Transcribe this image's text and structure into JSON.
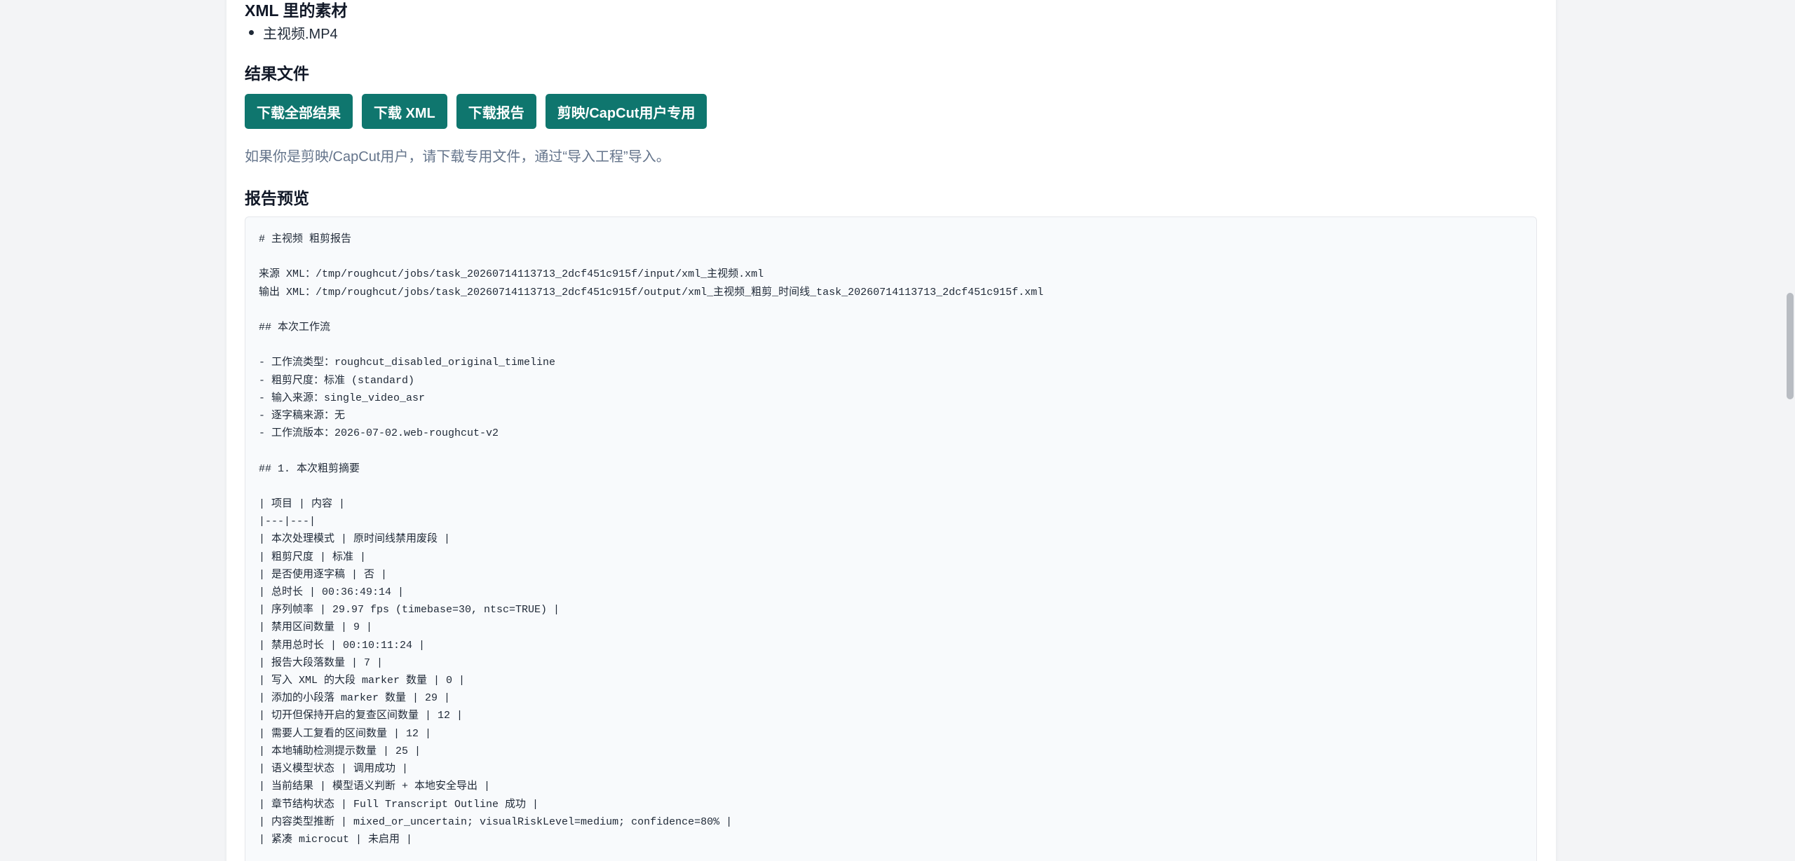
{
  "assets": {
    "title": "XML 里的素材",
    "items": [
      "主视频.MP4"
    ]
  },
  "results": {
    "title": "结果文件",
    "buttons": {
      "download_all": "下载全部结果",
      "download_xml": "下载 XML",
      "download_report": "下载报告",
      "capcut": "剪映/CapCut用户专用"
    },
    "hint": "如果你是剪映/CapCut用户，请下载专用文件，通过“导入工程”导入。"
  },
  "preview": {
    "title": "报告预览",
    "lines": [
      "# 主视频 粗剪报告",
      "",
      "来源 XML：/tmp/roughcut/jobs/task_20260714113713_2dcf451c915f/input/xml_主视频.xml",
      "输出 XML：/tmp/roughcut/jobs/task_20260714113713_2dcf451c915f/output/xml_主视频_粗剪_时间线_task_20260714113713_2dcf451c915f.xml",
      "",
      "## 本次工作流",
      "",
      "- 工作流类型：roughcut_disabled_original_timeline",
      "- 粗剪尺度：标准 (standard)",
      "- 输入来源：single_video_asr",
      "- 逐字稿来源：无",
      "- 工作流版本：2026-07-02.web-roughcut-v2",
      "",
      "## 1. 本次粗剪摘要",
      "",
      "| 项目 | 内容 |",
      "|---|---|",
      "| 本次处理模式 | 原时间线禁用废段 |",
      "| 粗剪尺度 | 标准 |",
      "| 是否使用逐字稿 | 否 |",
      "| 总时长 | 00:36:49:14 |",
      "| 序列帧率 | 29.97 fps (timebase=30, ntsc=TRUE) |",
      "| 禁用区间数量 | 9 |",
      "| 禁用总时长 | 00:10:11:24 |",
      "| 报告大段落数量 | 7 |",
      "| 写入 XML 的大段 marker 数量 | 0 |",
      "| 添加的小段落 marker 数量 | 29 |",
      "| 切开但保持开启的复查区间数量 | 12 |",
      "| 需要人工复看的区间数量 | 12 |",
      "| 本地辅助检测提示数量 | 25 |",
      "| 语义模型状态 | 调用成功 |",
      "| 当前结果 | 模型语义判断 + 本地安全导出 |",
      "| 章节结构状态 | Full Transcript Outline 成功 |",
      "| 内容类型推断 | mixed_or_uncertain; visualRiskLevel=medium; confidence=80% |",
      "| 紧凑 microcut | 未启用 |"
    ]
  },
  "colors": {
    "button_bg": "#0f766e",
    "hint_text": "#64748b",
    "report_bg": "#f8fafc"
  }
}
